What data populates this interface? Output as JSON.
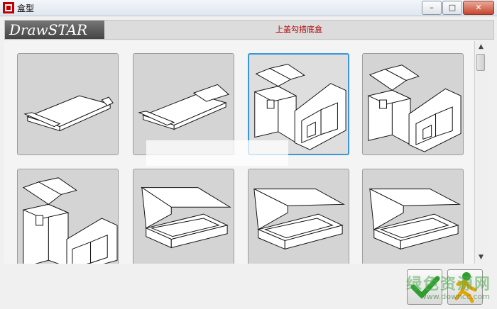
{
  "window": {
    "title": "盒型",
    "minimize": "–",
    "maximize": "□",
    "close": "✕"
  },
  "header": {
    "logo": "DrawSTAR",
    "title": "上盖勾措底盒"
  },
  "tiles": [
    {
      "selected": false,
      "icon": "flat-box-icon"
    },
    {
      "selected": false,
      "icon": "flat-box-icon"
    },
    {
      "selected": true,
      "icon": "tuck-box-icon"
    },
    {
      "selected": false,
      "icon": "tuck-box-icon"
    },
    {
      "selected": false,
      "icon": "tuck-box-icon"
    },
    {
      "selected": false,
      "icon": "open-tray-icon"
    },
    {
      "selected": false,
      "icon": "open-tray-icon"
    },
    {
      "selected": false,
      "icon": "open-tray-icon"
    }
  ],
  "watermark": {
    "text": "绿色资源网",
    "url": "www.downcc.com"
  },
  "colors": {
    "accent": "#3a96d6",
    "header_title": "#b00000",
    "ok": "#2e9e2e"
  }
}
